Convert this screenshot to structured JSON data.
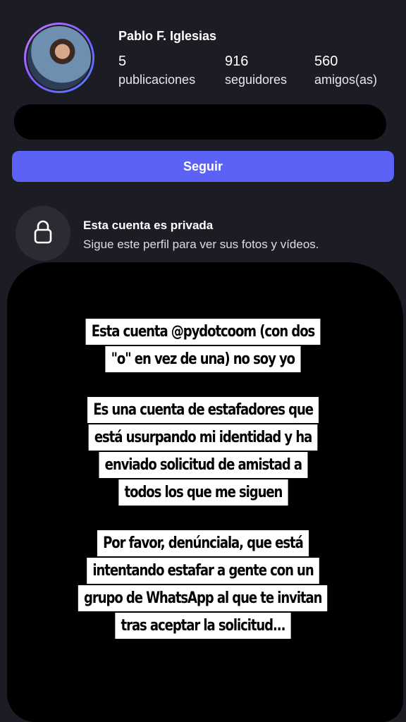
{
  "profile": {
    "name": "Pablo F. Iglesias",
    "stats": [
      {
        "value": "5",
        "label": "publicaciones"
      },
      {
        "value": "916",
        "label": "seguidores"
      },
      {
        "value": "560",
        "label": "amigos(as)"
      }
    ]
  },
  "actions": {
    "follow_label": "Seguir"
  },
  "private_notice": {
    "title": "Esta cuenta es privada",
    "subtitle": "Sigue este perfil para ver sus fotos y vídeos.",
    "icon": "lock-icon"
  },
  "story_text": {
    "paragraphs": [
      [
        "Esta cuenta @pydotcoom (con dos",
        "\"o\" en vez de una) no soy yo"
      ],
      [
        "Es una cuenta de estafadores que",
        "está usurpando mi identidad y ha",
        "enviado solicitud de amistad a",
        "todos los que me siguen"
      ],
      [
        "Por favor, denúnciala, que está",
        "intentando estafar a gente con un",
        "grupo de WhatsApp al que te invitan",
        "tras aceptar la solicitud..."
      ]
    ]
  },
  "colors": {
    "background": "#1c1c24",
    "accent": "#5b62f5",
    "redaction": "#000000"
  }
}
